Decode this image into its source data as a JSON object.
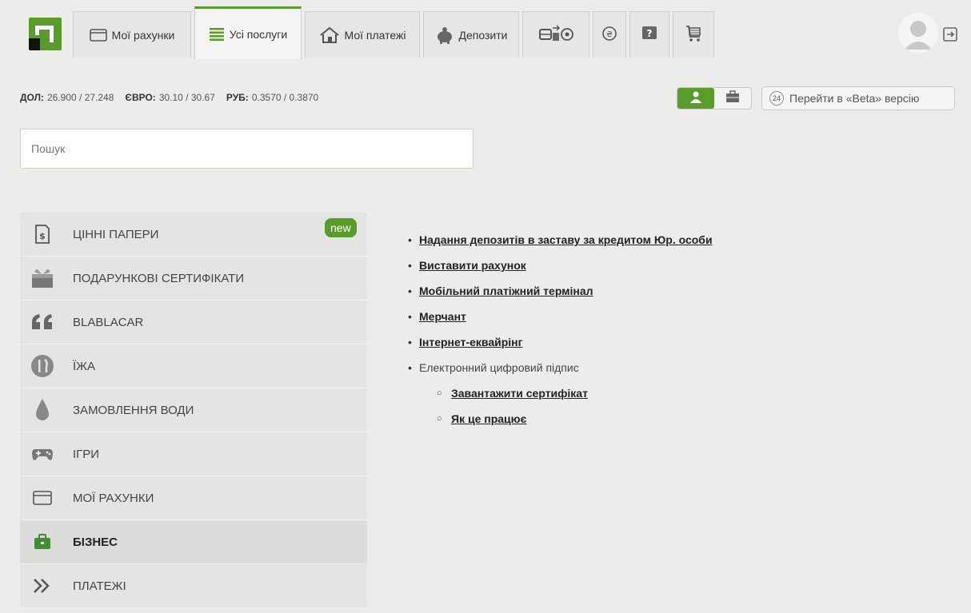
{
  "nav": {
    "tabs": [
      {
        "label": "Мої рахунки",
        "icon": "card-icon"
      },
      {
        "label": "Усі послуги",
        "icon": "list-icon"
      },
      {
        "label": "Мої платежі",
        "icon": "house-icon"
      },
      {
        "label": "Депозити",
        "icon": "piggy-bank-icon"
      }
    ],
    "icon_tabs": [
      "transport-icon",
      "currency-exchange-icon",
      "question-icon",
      "cart-icon"
    ]
  },
  "rates": [
    {
      "label": "ДОЛ:",
      "value": "26.900 / 27.248"
    },
    {
      "label": "ЄВРО:",
      "value": "30.10 / 30.67"
    },
    {
      "label": "РУБ:",
      "value": "0.3570 / 0.3870"
    }
  ],
  "beta": {
    "badge": "24",
    "label": "Перейти в «Beta» версію"
  },
  "search": {
    "placeholder": "Пошук"
  },
  "menu": {
    "new_badge": "new",
    "items": [
      {
        "label": "ЦІННІ ПАПЕРИ",
        "icon": "securities-icon"
      },
      {
        "label": "ПОДАРУНКОВІ СЕРТИФІКАТИ",
        "icon": "gift-icon"
      },
      {
        "label": "BLABLACAR",
        "icon": "quote-icon"
      },
      {
        "label": "ЇЖА",
        "icon": "food-icon"
      },
      {
        "label": "ЗАМОВЛЕННЯ ВОДИ",
        "icon": "water-drop-icon"
      },
      {
        "label": "ІГРИ",
        "icon": "gamepad-icon"
      },
      {
        "label": "МОЇ РАХУНКИ",
        "icon": "card-icon"
      },
      {
        "label": "БІЗНЕС",
        "icon": "briefcase-icon"
      },
      {
        "label": "ПЛАТЕЖІ",
        "icon": "double-chevron-icon"
      }
    ]
  },
  "content": {
    "links": [
      "Надання депозитів в заставу за кредитом Юр. особи",
      "Виставити рахунок",
      "Мобільний платіжний термінал",
      "Мерчант",
      "Інтернет-еквайрінг"
    ],
    "group_label": "Електронний цифровий підпис",
    "sub_links": [
      "Завантажити сертифікат",
      "Як це працює"
    ]
  },
  "colors": {
    "brand": "#5a9c2a",
    "background": "#ececeb"
  }
}
